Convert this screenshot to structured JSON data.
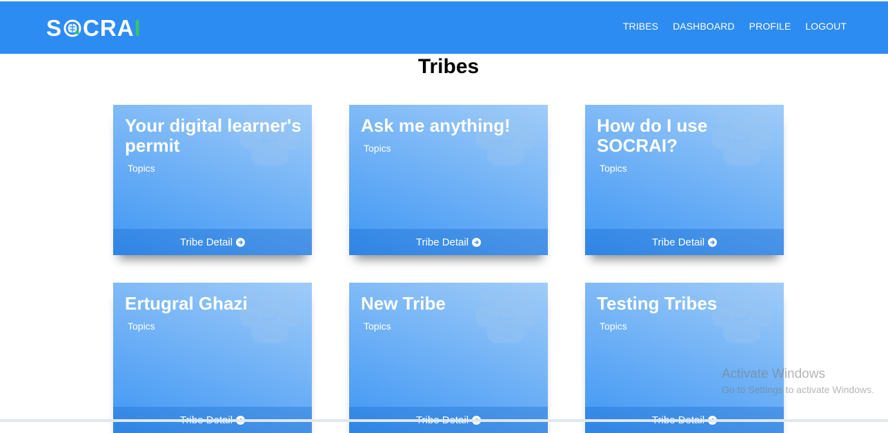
{
  "brand": {
    "logo_text_left": "S",
    "logo_text_mid": "CR",
    "logo_text_a": "A",
    "logo_text_i": "I",
    "colors": {
      "navbar": "#2d8cf2",
      "accent_green": "#35c46a"
    }
  },
  "nav": {
    "items": [
      {
        "label": "TRIBES"
      },
      {
        "label": "DASHBOARD"
      },
      {
        "label": "PROFILE"
      },
      {
        "label": "LOGOUT"
      }
    ]
  },
  "page": {
    "title": "Tribes"
  },
  "tribes": [
    {
      "title": "Your digital learner's permit",
      "topics": "Topics",
      "footer": "Tribe Detail",
      "icon": "users-icon"
    },
    {
      "title": "Ask me anything!",
      "topics": "Topics",
      "footer": "Tribe Detail",
      "icon": "users-icon"
    },
    {
      "title": "How do I use SOCRAI?",
      "topics": "Topics",
      "footer": "Tribe Detail",
      "icon": "users-icon"
    },
    {
      "title": "Ertugral Ghazi",
      "topics": "Topics",
      "footer": "Tribe Detail",
      "icon": "users-icon"
    },
    {
      "title": "New Tribe",
      "topics": "Topics",
      "footer": "Tribe Detail",
      "icon": "users-icon"
    },
    {
      "title": "Testing Tribes",
      "topics": "Topics",
      "footer": "Tribe Detail",
      "icon": "users-icon"
    }
  ],
  "watermark": {
    "line1": "Activate Windows",
    "line2": "Go to Settings to activate Windows."
  }
}
